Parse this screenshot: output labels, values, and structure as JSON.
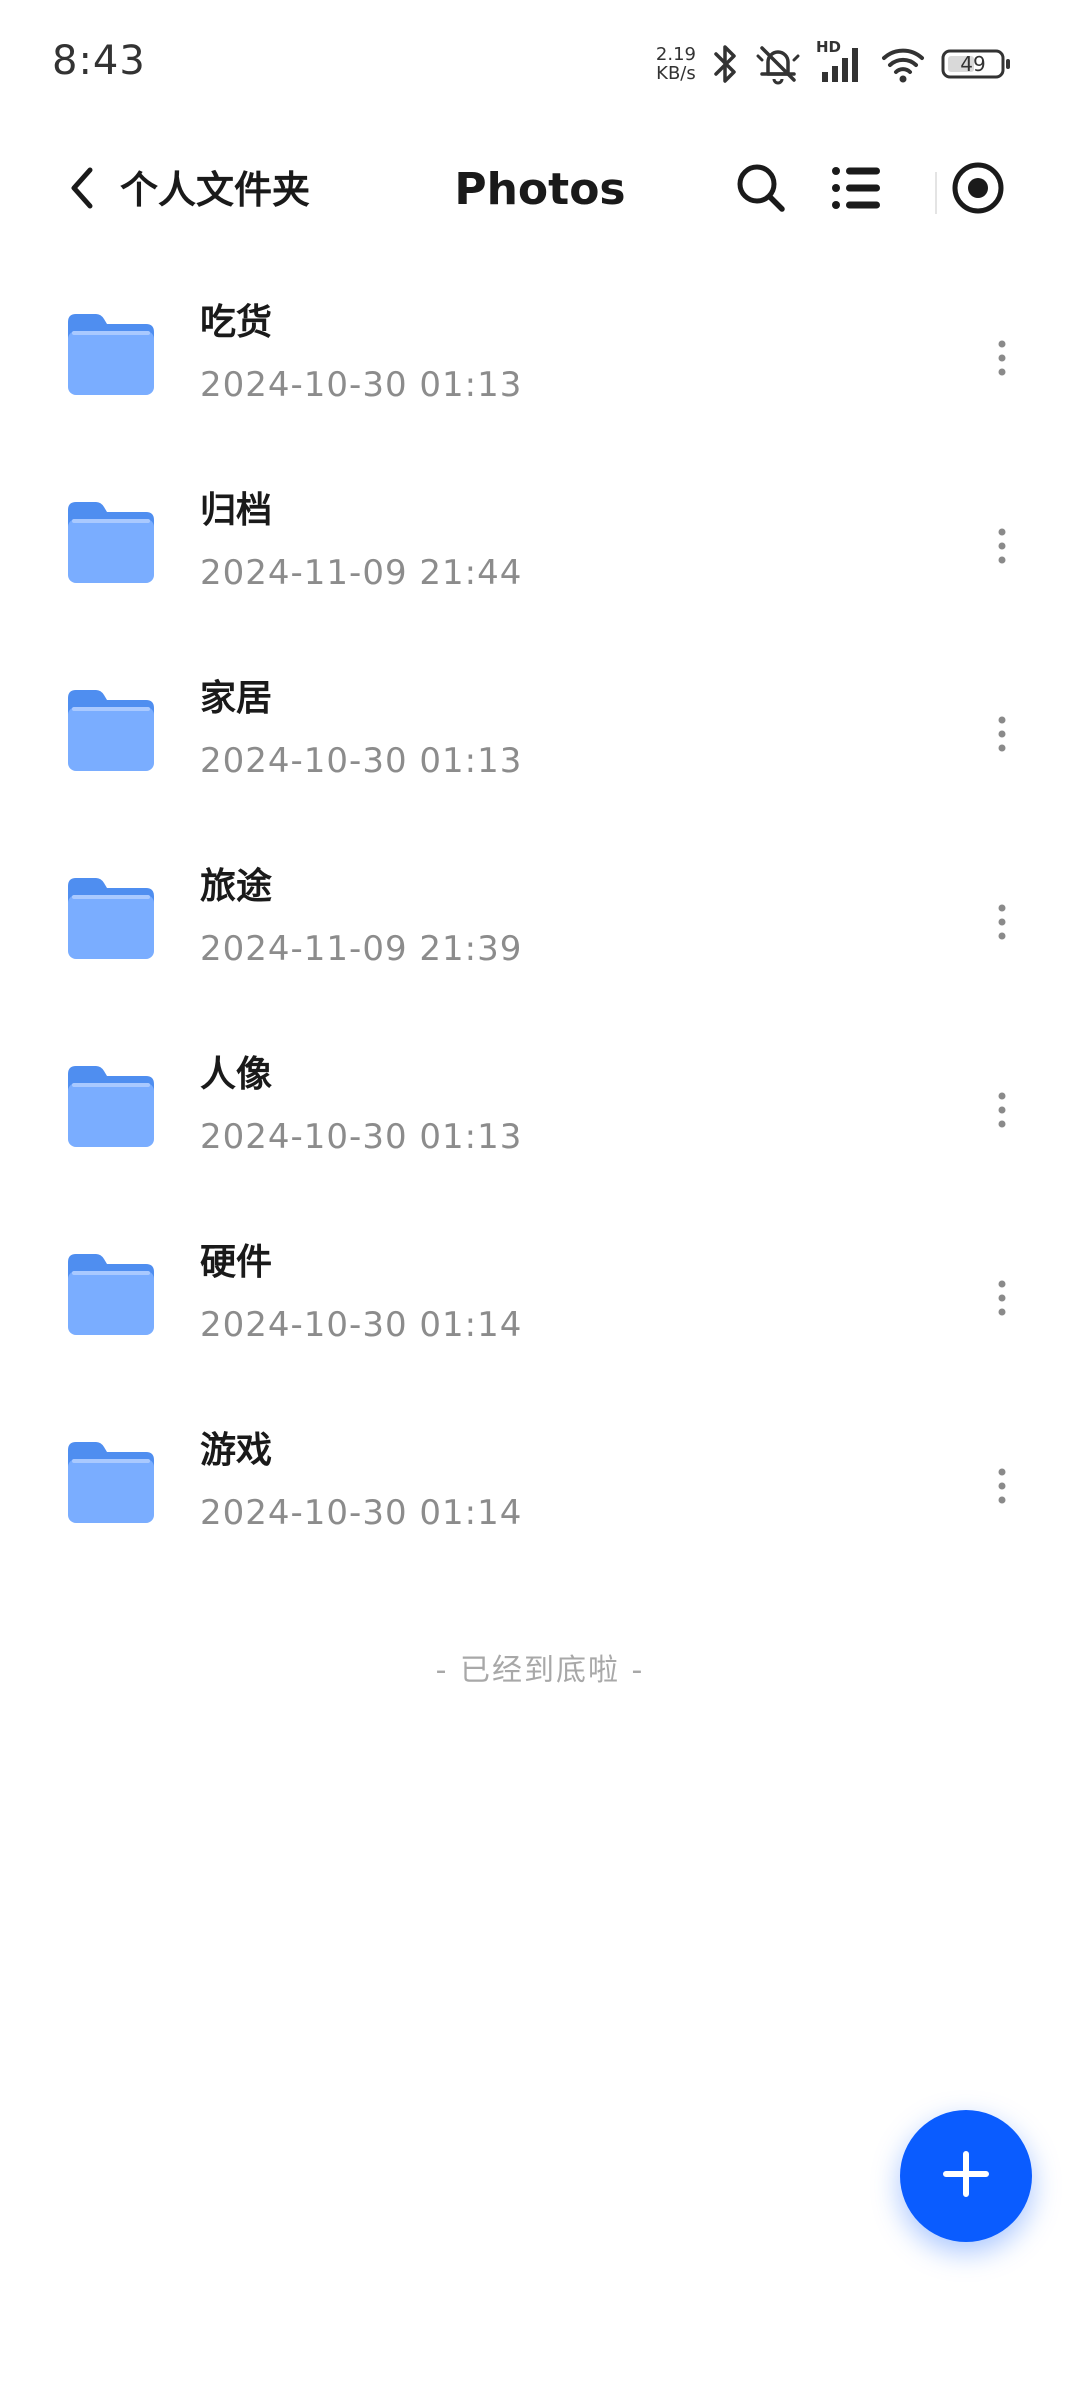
{
  "status_bar": {
    "time": "8:43",
    "net_speed_value": "2.19",
    "net_speed_unit": "KB/s",
    "hd_label": "HD",
    "battery": "49"
  },
  "header": {
    "breadcrumb": "个人文件夹",
    "title": "Photos"
  },
  "folders": [
    {
      "name": "吃货",
      "date": "2024-10-30 01:13"
    },
    {
      "name": "归档",
      "date": "2024-11-09 21:44"
    },
    {
      "name": "家居",
      "date": "2024-10-30 01:13"
    },
    {
      "name": "旅途",
      "date": "2024-11-09 21:39"
    },
    {
      "name": "人像",
      "date": "2024-10-30 01:13"
    },
    {
      "name": "硬件",
      "date": "2024-10-30 01:14"
    },
    {
      "name": "游戏",
      "date": "2024-10-30 01:14"
    }
  ],
  "footer": {
    "end_text": "- 已经到底啦 -"
  },
  "colors": {
    "accent": "#0a5cff",
    "folder_back": "#4f8ef0",
    "folder_front": "#7aadff",
    "secondary_text": "#8c8c8c"
  },
  "icons": {
    "back": "chevron-left-icon",
    "search": "search-icon",
    "list_view": "list-view-icon",
    "record": "record-icon",
    "more": "more-vertical-icon",
    "add": "plus-icon",
    "folder": "folder-icon"
  }
}
